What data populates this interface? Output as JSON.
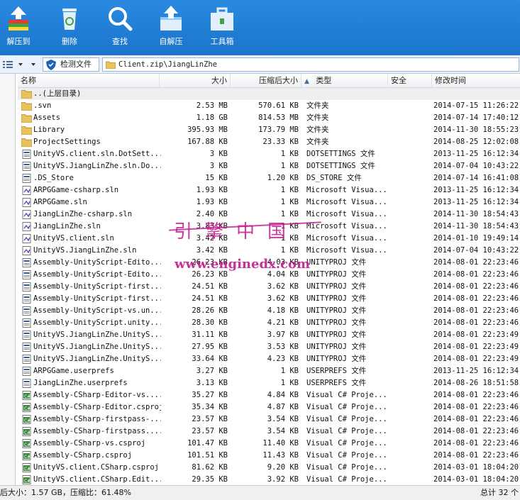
{
  "toolbar": {
    "buttons": [
      {
        "label": "解压到",
        "icon": "extract-icon"
      },
      {
        "label": "删除",
        "icon": "trash-icon"
      },
      {
        "label": "查找",
        "icon": "search-icon"
      },
      {
        "label": "自解压",
        "icon": "self-extract-icon"
      },
      {
        "label": "工具箱",
        "icon": "toolbox-icon"
      }
    ]
  },
  "addressbar": {
    "scan_label": "检测文件",
    "path": "Client.zip\\JiangLinZhe"
  },
  "columns": {
    "name": "名称",
    "size": "大小",
    "csize": "压缩后大小",
    "type": "类型",
    "security": "安全",
    "modified": "修改时间"
  },
  "parent_row": {
    "name": "..(上层目录)"
  },
  "rows": [
    {
      "name": ".svn",
      "size": "2.53 MB",
      "csize": "570.61 KB",
      "type": "文件夹",
      "date": "2014-07-15 11:26:22",
      "icon": "folder"
    },
    {
      "name": "Assets",
      "size": "1.18 GB",
      "csize": "814.53 MB",
      "type": "文件夹",
      "date": "2014-07-14 17:40:12",
      "icon": "folder"
    },
    {
      "name": "Library",
      "size": "395.93 MB",
      "csize": "173.79 MB",
      "type": "文件夹",
      "date": "2014-11-30 18:55:23",
      "icon": "folder"
    },
    {
      "name": "ProjectSettings",
      "size": "167.88 KB",
      "csize": "23.33 KB",
      "type": "文件夹",
      "date": "2014-08-25 12:02:08",
      "icon": "folder"
    },
    {
      "name": "UnityVS.client.sln.DotSett...",
      "size": "3 KB",
      "csize": "1 KB",
      "type": "DOTSETTINGS 文件",
      "date": "2013-11-25 16:12:34",
      "icon": "file"
    },
    {
      "name": "UnityVS.JiangLinZhe.sln.Do...",
      "size": "3 KB",
      "csize": "1 KB",
      "type": "DOTSETTINGS 文件",
      "date": "2014-07-04 10:43:22",
      "icon": "file"
    },
    {
      "name": ".DS_Store",
      "size": "15 KB",
      "csize": "1.20 KB",
      "type": "DS_STORE 文件",
      "date": "2014-07-14 16:41:08",
      "icon": "file"
    },
    {
      "name": "ARPGGame-csharp.sln",
      "size": "1.93 KB",
      "csize": "1 KB",
      "type": "Microsoft Visua...",
      "date": "2013-11-25 16:12:34",
      "icon": "sln"
    },
    {
      "name": "ARPGGame.sln",
      "size": "1.93 KB",
      "csize": "1 KB",
      "type": "Microsoft Visua...",
      "date": "2013-11-25 16:12:34",
      "icon": "sln"
    },
    {
      "name": "JiangLinZhe-csharp.sln",
      "size": "2.40 KB",
      "csize": "1 KB",
      "type": "Microsoft Visua...",
      "date": "2014-11-30 18:54:43",
      "icon": "sln"
    },
    {
      "name": "JiangLinZhe.sln",
      "size": "3.83 KB",
      "csize": "1 KB",
      "type": "Microsoft Visua...",
      "date": "2014-11-30 18:54:43",
      "icon": "sln"
    },
    {
      "name": "UnityVS.client.sln",
      "size": "3.42 KB",
      "csize": "1 KB",
      "type": "Microsoft Visua...",
      "date": "2014-01-10 19:49:14",
      "icon": "sln"
    },
    {
      "name": "UnityVS.JiangLinZhe.sln",
      "size": "3.42 KB",
      "csize": "1 KB",
      "type": "Microsoft Visua...",
      "date": "2014-07-04 10:43:22",
      "icon": "sln"
    },
    {
      "name": "Assembly-UnityScript-Edito...",
      "size": "26.23 KB",
      "csize": "4.03 KB",
      "type": "UNITYPROJ 文件",
      "date": "2014-08-01 22:23:46",
      "icon": "file"
    },
    {
      "name": "Assembly-UnityScript-Edito...",
      "size": "26.23 KB",
      "csize": "4.04 KB",
      "type": "UNITYPROJ 文件",
      "date": "2014-08-01 22:23:46",
      "icon": "file"
    },
    {
      "name": "Assembly-UnityScript-first...",
      "size": "24.51 KB",
      "csize": "3.62 KB",
      "type": "UNITYPROJ 文件",
      "date": "2014-08-01 22:23:46",
      "icon": "file"
    },
    {
      "name": "Assembly-UnityScript-first...",
      "size": "24.51 KB",
      "csize": "3.62 KB",
      "type": "UNITYPROJ 文件",
      "date": "2014-08-01 22:23:46",
      "icon": "file"
    },
    {
      "name": "Assembly-UnityScript-vs.un...",
      "size": "28.26 KB",
      "csize": "4.18 KB",
      "type": "UNITYPROJ 文件",
      "date": "2014-08-01 22:23:46",
      "icon": "file"
    },
    {
      "name": "Assembly-UnityScript.unity...",
      "size": "28.30 KB",
      "csize": "4.21 KB",
      "type": "UNITYPROJ 文件",
      "date": "2014-08-01 22:23:46",
      "icon": "file"
    },
    {
      "name": "UnityVS.JiangLinZhe.UnityS...",
      "size": "31.11 KB",
      "csize": "3.97 KB",
      "type": "UNITYPROJ 文件",
      "date": "2014-08-01 22:23:49",
      "icon": "file"
    },
    {
      "name": "UnityVS.JiangLinZhe.UnityS...",
      "size": "27.95 KB",
      "csize": "3.53 KB",
      "type": "UNITYPROJ 文件",
      "date": "2014-08-01 22:23:49",
      "icon": "file"
    },
    {
      "name": "UnityVS.JiangLinZhe.UnityS...",
      "size": "33.64 KB",
      "csize": "4.23 KB",
      "type": "UNITYPROJ 文件",
      "date": "2014-08-01 22:23:49",
      "icon": "file"
    },
    {
      "name": "ARPGGame.userprefs",
      "size": "3.27 KB",
      "csize": "1 KB",
      "type": "USERPREFS 文件",
      "date": "2013-11-25 16:12:34",
      "icon": "file"
    },
    {
      "name": "JiangLinZhe.userprefs",
      "size": "3.13 KB",
      "csize": "1 KB",
      "type": "USERPREFS 文件",
      "date": "2014-08-26 18:51:58",
      "icon": "file"
    },
    {
      "name": "Assembly-CSharp-Editor-vs....",
      "size": "35.27 KB",
      "csize": "4.84 KB",
      "type": "Visual C# Proje...",
      "date": "2014-08-01 22:23:46",
      "icon": "csproj"
    },
    {
      "name": "Assembly-CSharp-Editor.csproj",
      "size": "35.34 KB",
      "csize": "4.87 KB",
      "type": "Visual C# Proje...",
      "date": "2014-08-01 22:23:46",
      "icon": "csproj"
    },
    {
      "name": "Assembly-CSharp-firstpass-...",
      "size": "23.57 KB",
      "csize": "3.54 KB",
      "type": "Visual C# Proje...",
      "date": "2014-08-01 22:23:46",
      "icon": "csproj"
    },
    {
      "name": "Assembly-CSharp-firstpass....",
      "size": "23.57 KB",
      "csize": "3.54 KB",
      "type": "Visual C# Proje...",
      "date": "2014-08-01 22:23:46",
      "icon": "csproj"
    },
    {
      "name": "Assembly-CSharp-vs.csproj",
      "size": "101.47 KB",
      "csize": "11.40 KB",
      "type": "Visual C# Proje...",
      "date": "2014-08-01 22:23:46",
      "icon": "csproj"
    },
    {
      "name": "Assembly-CSharp.csproj",
      "size": "101.51 KB",
      "csize": "11.43 KB",
      "type": "Visual C# Proje...",
      "date": "2014-08-01 22:23:46",
      "icon": "csproj"
    },
    {
      "name": "UnityVS.client.CSharp.csproj",
      "size": "81.62 KB",
      "csize": "9.20 KB",
      "type": "Visual C# Proje...",
      "date": "2014-03-01 18:04:20",
      "icon": "csproj"
    },
    {
      "name": "UnityVS.client.CSharp.Edit...",
      "size": "29.35 KB",
      "csize": "3.92 KB",
      "type": "Visual C# Proje...",
      "date": "2014-03-01 18:04:20",
      "icon": "csproj"
    }
  ],
  "status": {
    "left": "后大小：1.57 GB，压缩比：61.48%",
    "right": "总计 32 个"
  },
  "watermark": {
    "line1": "引擎中国",
    "line2": "www.enginedx.com"
  },
  "colors": {
    "toolbar": "#1b74cc",
    "watermark": "#c21a8c"
  }
}
